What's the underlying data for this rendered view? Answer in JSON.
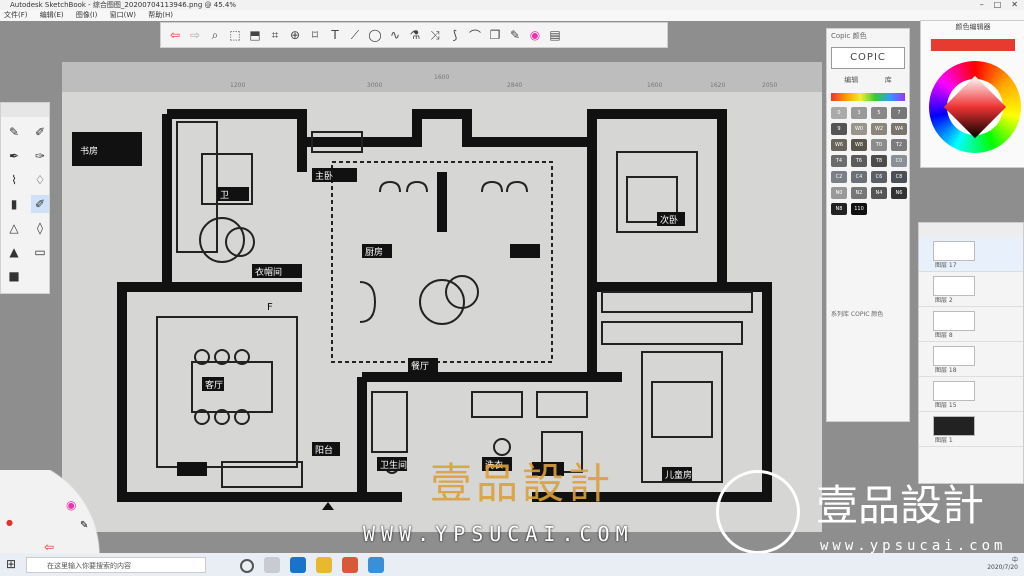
{
  "window": {
    "title": "Autodesk SketchBook - 综合图图_20200704113946.png @ 45.4%"
  },
  "menu": [
    "文件(F)",
    "编辑(E)",
    "图像(I)",
    "窗口(W)",
    "帮助(H)"
  ],
  "toolbar_icons": [
    "undo-icon",
    "redo-icon",
    "zoom-icon",
    "select-icon",
    "transform-icon",
    "crop-icon",
    "symmetry-icon",
    "perspective-icon",
    "text-icon",
    "ruler-icon",
    "ellipse-icon",
    "curve-icon",
    "fill-icon",
    "distort-icon",
    "stroke-icon",
    "brush-icon",
    "color-icon",
    "copic-icon",
    "palette-icon",
    "color-wheel-icon"
  ],
  "ruler_labels": [
    "1200",
    "3000",
    "1600",
    "2840",
    "1600",
    "1620",
    "2050"
  ],
  "copic": {
    "header": "Copic 颜色",
    "logo": "COPIC",
    "tabs": [
      "编辑",
      "库"
    ],
    "footer": "系列库 COPIC 颜色",
    "swatch_labels": [
      "0",
      "3",
      "5",
      "7",
      "9",
      "W0",
      "W2",
      "W4",
      "W6",
      "W8",
      "T0",
      "T2",
      "T4",
      "T6",
      "T8",
      "C0",
      "C2",
      "C4",
      "C6",
      "C8",
      "N0",
      "N2",
      "N4",
      "N6",
      "N8",
      "110"
    ]
  },
  "color_editor": {
    "title": "颜色编辑器",
    "swatch": "#e63b2e"
  },
  "layers": [
    {
      "label": "图层 17",
      "selected": true,
      "dark": false
    },
    {
      "label": "图层 2",
      "selected": false,
      "dark": false
    },
    {
      "label": "图层 8",
      "selected": false,
      "dark": false
    },
    {
      "label": "图层 18",
      "selected": false,
      "dark": false
    },
    {
      "label": "图层 15",
      "selected": false,
      "dark": false
    },
    {
      "label": "图层 1",
      "selected": false,
      "dark": true
    }
  ],
  "watermark": {
    "text": "壹品設計",
    "site": "WWW.YPSUCAI.COM"
  },
  "brand": {
    "name": "壹品設計",
    "url": "www.ypsucai.com"
  },
  "taskbar": {
    "search": "在这里输入你要搜索的内容",
    "date": "2020/7/20",
    "ime": "中",
    "time": ""
  },
  "plan_labels": [
    "书房",
    "卫",
    "衣帽间",
    "主卧",
    "厨房",
    "餐厅",
    "客厅",
    "次卧",
    "阳台",
    "卫生间",
    "洗衣",
    "儿童房",
    "F"
  ]
}
